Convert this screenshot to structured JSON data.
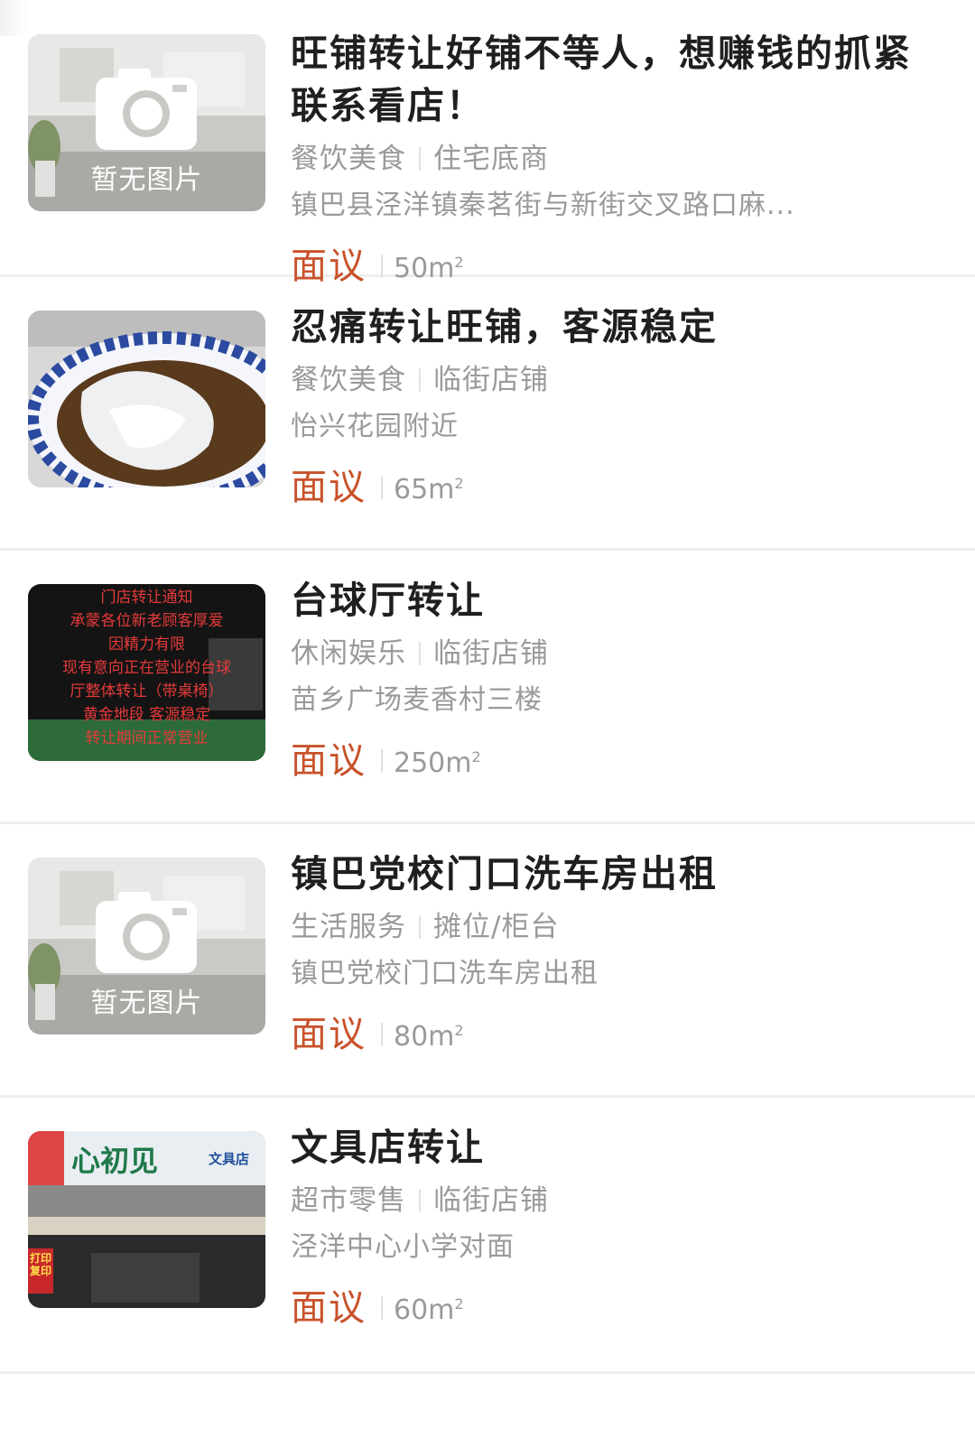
{
  "listings": [
    {
      "title": "旺铺转让好铺不等人，想赚钱的抓紧联系看店！",
      "tags": [
        "餐饮美食",
        "住宅底商"
      ],
      "address": "镇巴县泾洋镇秦茗街与新街交叉路口麻...",
      "price": "面议",
      "area": "50m",
      "area_unit_sup": "2",
      "image": {
        "type": "placeholder",
        "caption": "暂无图片"
      }
    },
    {
      "title": "忍痛转让旺铺，客源稳定",
      "tags": [
        "餐饮美食",
        "临街店铺"
      ],
      "address": "怡兴花园附近",
      "price": "面议",
      "area": "65m",
      "area_unit_sup": "2",
      "image": {
        "type": "photo-food"
      }
    },
    {
      "title": "台球厅转让",
      "tags": [
        "休闲娱乐",
        "临街店铺"
      ],
      "address": "苗乡广场麦香村三楼",
      "price": "面议",
      "area": "250m",
      "area_unit_sup": "2",
      "image": {
        "type": "photo-notice",
        "lines": [
          "门店转让通知",
          "承蒙各位新老顾客厚爱",
          "因精力有限",
          "现有意向正在营业的台球",
          "厅整体转让（带桌椅）",
          "黄金地段 客源稳定",
          "转让期间正常营业"
        ]
      }
    },
    {
      "title": "镇巴党校门口洗车房出租",
      "tags": [
        "生活服务",
        "摊位/柜台"
      ],
      "address": "镇巴党校门口洗车房出租",
      "price": "面议",
      "area": "80m",
      "area_unit_sup": "2",
      "image": {
        "type": "placeholder",
        "caption": "暂无图片"
      }
    },
    {
      "title": "文具店转让",
      "tags": [
        "超市零售",
        "临街店铺"
      ],
      "address": "泾洋中心小学对面",
      "price": "面议",
      "area": "60m",
      "area_unit_sup": "2",
      "image": {
        "type": "photo-shop",
        "sign": "心初见",
        "sign_sub": "文具店",
        "side": [
          "打印",
          "复印"
        ]
      }
    }
  ],
  "colors": {
    "price": "#c8522a",
    "muted_text": "#9a9a9a",
    "title_text": "#1f1f1f",
    "divider": "#eeeeee"
  }
}
